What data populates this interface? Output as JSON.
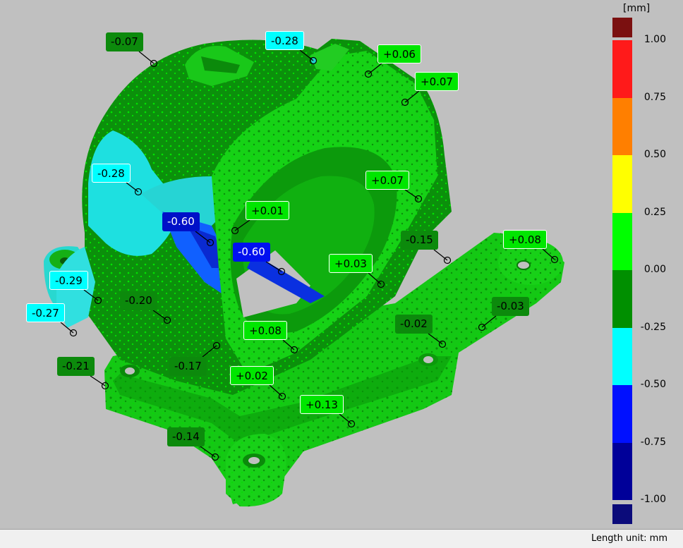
{
  "legend": {
    "unit": "[mm]",
    "ticks": [
      "1.00",
      "0.75",
      "0.50",
      "0.25",
      "0.00",
      "-0.25",
      "-0.50",
      "-0.75",
      "-1.00"
    ],
    "colors": {
      "over_range": "#7b1010",
      "bands": [
        "#ff1a1a",
        "#ff7f00",
        "#ffff00",
        "#00ff00",
        "#008f00",
        "#00ffff",
        "#0010ff",
        "#000099"
      ],
      "under_range": "#0b0b7a"
    }
  },
  "annotations": [
    {
      "text": "-0.07",
      "bg": "#0c8a0c",
      "fg": "#000000"
    },
    {
      "text": "-0.28",
      "bg": "#00ffff",
      "fg": "#000000"
    },
    {
      "text": "+0.06",
      "bg": "#00e600",
      "fg": "#000000"
    },
    {
      "text": "+0.07",
      "bg": "#00e600",
      "fg": "#000000"
    },
    {
      "text": "-0.28",
      "bg": "#00ffff",
      "fg": "#000000"
    },
    {
      "text": "+0.07",
      "bg": "#00e600",
      "fg": "#000000"
    },
    {
      "text": "+0.01",
      "bg": "#00e600",
      "fg": "#000000"
    },
    {
      "text": "-0.60",
      "bg": "#0010c8",
      "fg": "#ffffff"
    },
    {
      "text": "-0.60",
      "bg": "#0010f0",
      "fg": "#ffffff"
    },
    {
      "text": "-0.15",
      "bg": "#0c8a0c",
      "fg": "#000000"
    },
    {
      "text": "+0.08",
      "bg": "#00e600",
      "fg": "#000000"
    },
    {
      "text": "+0.03",
      "bg": "#00e600",
      "fg": "#000000"
    },
    {
      "text": "-0.29",
      "bg": "#00ffff",
      "fg": "#000000"
    },
    {
      "text": "-0.20",
      "bg": "#0c8a0c",
      "fg": "#000000"
    },
    {
      "text": "-0.27",
      "bg": "#00ffff",
      "fg": "#000000"
    },
    {
      "text": "-0.03",
      "bg": "#0c8a0c",
      "fg": "#000000"
    },
    {
      "text": "-0.02",
      "bg": "#0c8a0c",
      "fg": "#000000"
    },
    {
      "text": "+0.08",
      "bg": "#00e600",
      "fg": "#000000"
    },
    {
      "text": "-0.21",
      "bg": "#0c8a0c",
      "fg": "#000000"
    },
    {
      "text": "-0.17",
      "bg": "#0c8a0c",
      "fg": "#000000"
    },
    {
      "text": "+0.02",
      "bg": "#00e600",
      "fg": "#000000"
    },
    {
      "text": "+0.13",
      "bg": "#00e600",
      "fg": "#000000"
    },
    {
      "text": "-0.14",
      "bg": "#0c8a0c",
      "fg": "#000000"
    }
  ],
  "status_bar": {
    "text": "Length unit: mm"
  }
}
